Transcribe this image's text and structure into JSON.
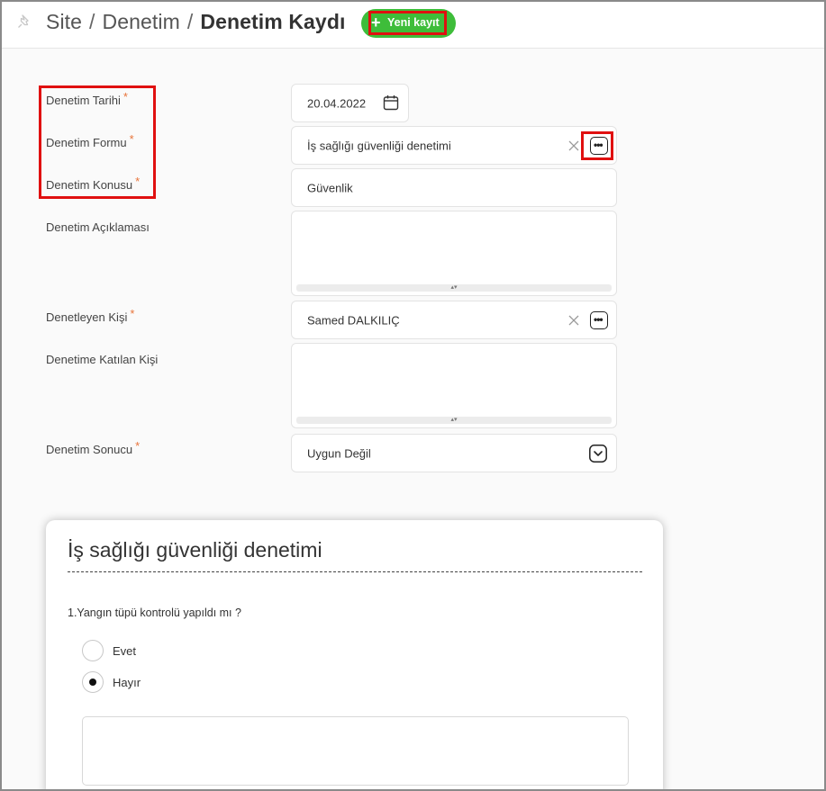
{
  "breadcrumb": {
    "site": "Site",
    "sep1": "/",
    "section": "Denetim",
    "sep2": "/",
    "current": "Denetim Kaydı"
  },
  "new_button": {
    "icon": "+",
    "label": "Yeni kayıt"
  },
  "form": {
    "required_mark": "*",
    "date": {
      "label": "Denetim Tarihi",
      "value": "20.04.2022",
      "icon": "calendar-icon"
    },
    "form_name": {
      "label": "Denetim Formu",
      "value": "İş sağlığı güvenliği denetimi"
    },
    "topic": {
      "label": "Denetim Konusu",
      "value": "Güvenlik"
    },
    "description": {
      "label": "Denetim Açıklaması",
      "value": ""
    },
    "inspector": {
      "label": "Denetleyen Kişi",
      "value": "Samed DALKILIÇ"
    },
    "participants": {
      "label": "Denetime Katılan Kişi",
      "value": ""
    },
    "result": {
      "label": "Denetim Sonucu",
      "value": "Uygun Değil",
      "icon": "chevron-down-icon"
    },
    "more_glyph": "•••",
    "resize_glyph": "▴▾"
  },
  "card": {
    "title": "İş sağlığı güvenliği denetimi",
    "question": "1.Yangın tüpü kontrolü yapıldı mı ?",
    "options": [
      {
        "label": "Evet",
        "selected": false
      },
      {
        "label": "Hayır",
        "selected": true
      }
    ],
    "note": ""
  },
  "colors": {
    "accent_green": "#3ebd3a",
    "required": "#e8743b",
    "highlight_red": "#e01010"
  }
}
